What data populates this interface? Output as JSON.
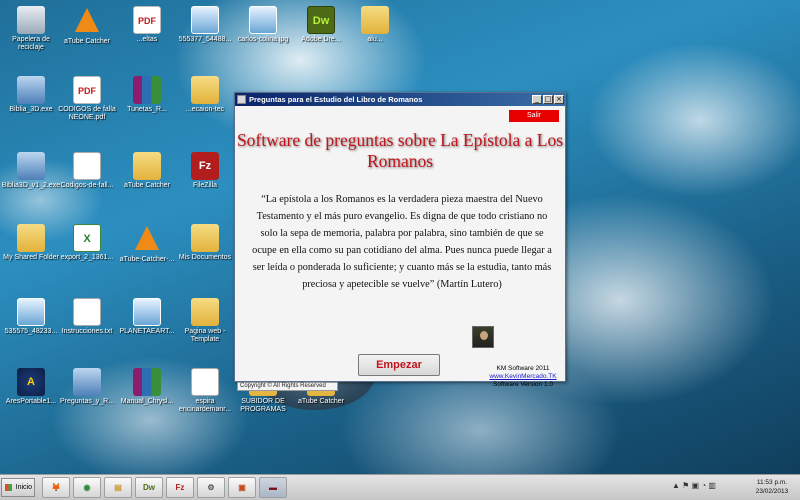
{
  "desktop": {
    "icons": [
      {
        "label": "Papelera de reciclaje",
        "icon": "recycle-bin-icon"
      },
      {
        "label": "aTube Catcher",
        "icon": "vlc-icon"
      },
      {
        "label": "...eltas",
        "icon": "pdf-icon"
      },
      {
        "label": "555377_54488...",
        "icon": "image-icon"
      },
      {
        "label": "carlos-colina.jpg",
        "icon": "image-icon"
      },
      {
        "label": "Adobe Dre...",
        "icon": "dreamweaver-icon"
      },
      {
        "label": "alu...",
        "icon": "folder-icon"
      },
      {
        "label": "Biblia_3D.exe",
        "icon": "exe-icon"
      },
      {
        "label": "CODIGOS de falla NEONE.pdf",
        "icon": "pdf-icon"
      },
      {
        "label": "Tunetas_R...",
        "icon": "rar-icon"
      },
      {
        "label": "...ecaion-tec",
        "icon": "folder-icon"
      },
      {
        "label": "Biblia3D_v1_2.exe",
        "icon": "exe-icon"
      },
      {
        "label": "Codigos-de-fall...",
        "icon": "document-icon"
      },
      {
        "label": "aTube Catcher",
        "icon": "folder-icon"
      },
      {
        "label": "FileZilla",
        "icon": "filezilla-icon"
      },
      {
        "label": "My Shared Folder",
        "icon": "folder-icon"
      },
      {
        "label": "export_2_1361...",
        "icon": "excel-icon"
      },
      {
        "label": "aTube-Catcher-...",
        "icon": "vlc-icon"
      },
      {
        "label": "Mis Documentos",
        "icon": "folder-icon"
      },
      {
        "label": "535575_48233...",
        "icon": "image-icon"
      },
      {
        "label": "Instrucciones.txt",
        "icon": "document-icon"
      },
      {
        "label": "PLANETAEART...",
        "icon": "image-icon"
      },
      {
        "label": "Pagina web - Template",
        "icon": "folder-icon"
      },
      {
        "label": "AresPortable1...",
        "icon": "ares-icon"
      },
      {
        "label": "Preguntas_y_R...",
        "icon": "exe-icon"
      },
      {
        "label": "Manual_Chrysl...",
        "icon": "rar-icon"
      },
      {
        "label": "espira encinardemanr...",
        "icon": "document-icon"
      },
      {
        "label": "SUBIDOR DE PROGRAMAS",
        "icon": "folder-icon"
      },
      {
        "label": "aTube Catcher",
        "icon": "folder-icon"
      }
    ]
  },
  "window": {
    "title": "Preguntas para el Estudio del Libro de Romanos",
    "minimize": "_",
    "maximize": "□",
    "close": "×",
    "salir_label": "Salir",
    "headline": "Software de preguntas sobre La Epístola a Los Romanos",
    "quote": "“La epístola a los Romanos es la verdadera pieza maestra del Nuevo Testamento y el más puro evangelio. Es digna de que todo cristiano no solo la sepa de memoria, palabra por palabra, sino también de que se ocupe en ella como su pan cotidiano del alma. Pues nunca puede llegar a ser leída o ponderada lo suficiente; y cuanto más se la estudia, tanto más preciosa y apetecible se vuelve” (Martín Lutero)",
    "start_button": "Empezar",
    "copyright": "Copyright © All Rights Reserved",
    "company": "KM Software 2011",
    "website": "www.KevinMercado.TK",
    "version": "Software Version 1.0"
  },
  "taskbar": {
    "start_label": "Inicio",
    "buttons": [
      {
        "name": "firefox",
        "glyph": "🦊"
      },
      {
        "name": "chrome",
        "glyph": "◉"
      },
      {
        "name": "explorer",
        "glyph": "▤"
      },
      {
        "name": "dreamweaver",
        "glyph": "Dw"
      },
      {
        "name": "filezilla",
        "glyph": "Fz"
      },
      {
        "name": "tools",
        "glyph": "⚙"
      },
      {
        "name": "presentation",
        "glyph": "▣"
      },
      {
        "name": "romanos-app",
        "glyph": "▬"
      }
    ],
    "time": "11:53 p.m.",
    "date": "23/02/2013"
  }
}
